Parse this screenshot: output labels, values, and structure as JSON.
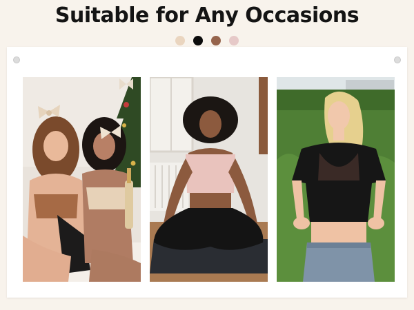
{
  "header": {
    "title": "Suitable for Any Occasions"
  },
  "swatches": [
    {
      "name": "nude",
      "color": "#ead5bf"
    },
    {
      "name": "black",
      "color": "#0c0c0c"
    },
    {
      "name": "mocha",
      "color": "#96644c"
    },
    {
      "name": "blush",
      "color": "#e6c9c8"
    }
  ],
  "photos": [
    {
      "scene": "two women in bralettes posing by a christmas tree"
    },
    {
      "scene": "woman meditating on a yoga mat in a pink bralette"
    },
    {
      "scene": "woman in a black mesh crop top outdoors on grass"
    }
  ]
}
